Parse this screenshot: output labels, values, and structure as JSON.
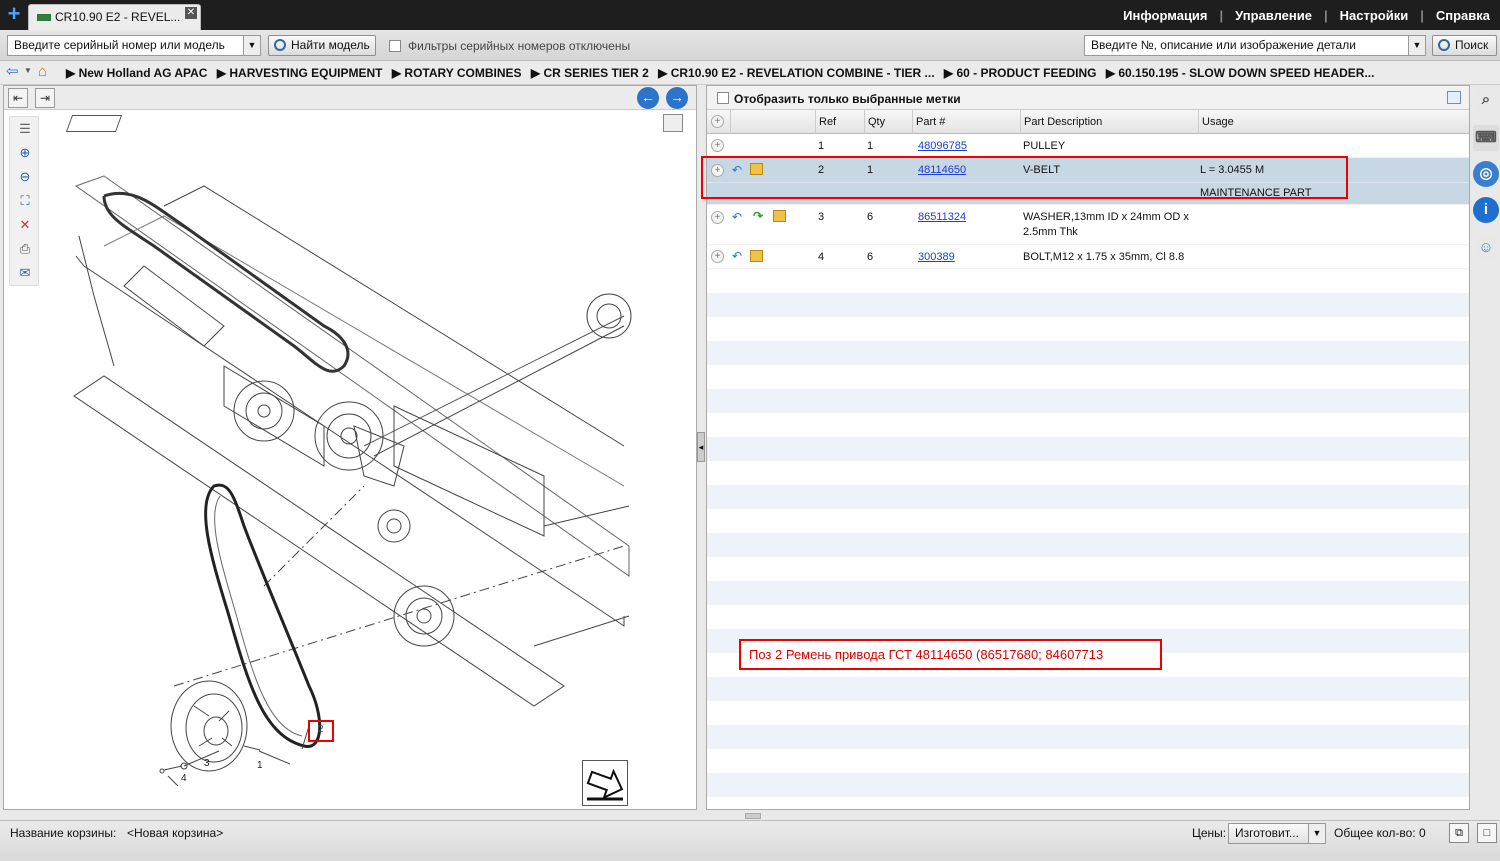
{
  "tabs": [
    {
      "label": "CR10.90 E2 - REVEL..."
    }
  ],
  "menu": [
    "Информация",
    "Управление",
    "Настройки",
    "Справка"
  ],
  "toolbar": {
    "serial_value": "Введите серийный номер или модель",
    "find_model": "Найти модель",
    "filters_label": "Фильтры серийных номеров отключены",
    "part_search_value": "Введите №, описание или изображение детали",
    "search_button": "Поиск"
  },
  "breadcrumb": [
    "▶ New Holland AG APAC",
    "▶ HARVESTING EQUIPMENT",
    "▶ ROTARY COMBINES",
    "▶ CR SERIES TIER 2",
    "▶ CR10.90 E2 - REVELATION COMBINE - TIER ...",
    "▶ 60 - PRODUCT FEEDING",
    "▶ 60.150.195 - SLOW DOWN SPEED HEADER..."
  ],
  "drawing": {
    "callouts": [
      "1",
      "2",
      "3",
      "4"
    ]
  },
  "parts_panel": {
    "show_selected_label": "Отобразить только выбранные метки",
    "columns": {
      "ref": "Ref",
      "qty": "Qty",
      "part": "Part #",
      "desc": "Part Description",
      "usage": "Usage"
    },
    "rows": [
      {
        "ref": "1",
        "qty": "1",
        "part": "48096785",
        "desc": "PULLEY",
        "desc2": "",
        "usage": "",
        "usage2": ""
      },
      {
        "ref": "2",
        "qty": "1",
        "part": "48114650",
        "desc": "V-BELT",
        "desc2": "",
        "usage": "L = 3.0455 M",
        "usage2": "MAINTENANCE PART"
      },
      {
        "ref": "3",
        "qty": "6",
        "part": "86511324",
        "desc": "WASHER,13mm ID x 24mm OD x",
        "desc2": "2.5mm Thk",
        "usage": "",
        "usage2": ""
      },
      {
        "ref": "4",
        "qty": "6",
        "part": "300389",
        "desc": "BOLT,M12 x 1.75 x 35mm, Cl 8.8",
        "desc2": "",
        "usage": "",
        "usage2": ""
      }
    ],
    "annotation": "Поз 2 Ремень привода ГСТ 48114650 (86517680; 84607713"
  },
  "footer": {
    "basket_label": "Название корзины:",
    "basket_name": "<Новая корзина>",
    "prices_label": "Цены:",
    "prices_value": "Изготовит...",
    "total_qty": "Общее кол-во: 0"
  },
  "colors": {
    "highlight": "#e00000",
    "selected_row": "#c8d7e4",
    "link": "#1a3fd1",
    "topbar": "#1e1e1e"
  }
}
